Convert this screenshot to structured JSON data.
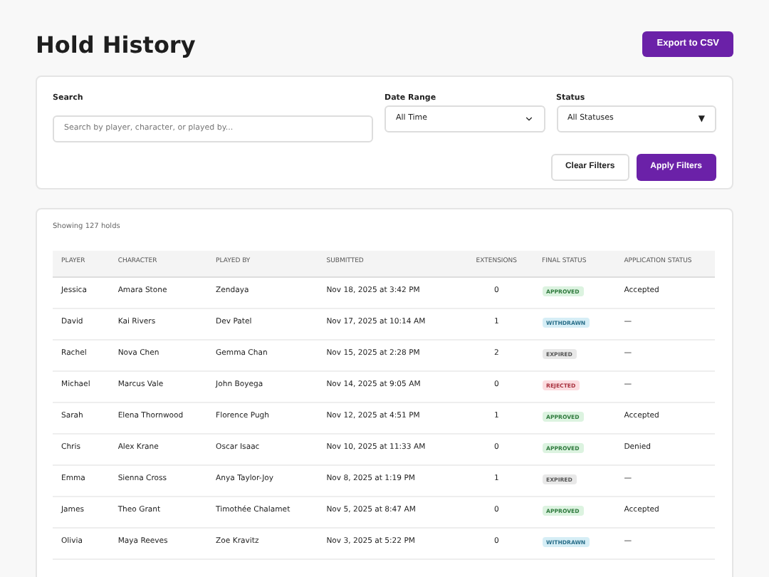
{
  "title": "Hold History",
  "export_button": "Export to CSV",
  "filters": {
    "search": {
      "label": "Search",
      "placeholder": "Search by player, character, or played by..."
    },
    "date_range": {
      "label": "Date Range",
      "value": "All Time"
    },
    "status": {
      "label": "Status",
      "value": "All Statuses",
      "caret": "▼"
    },
    "clear_button": "Clear Filters",
    "apply_button": "Apply Filters"
  },
  "summary": "Showing 127 holds",
  "table": {
    "columns": [
      "PLAYER",
      "CHARACTER",
      "PLAYED BY",
      "SUBMITTED",
      "EXTENSIONS",
      "FINAL STATUS",
      "APPLICATION STATUS"
    ],
    "rows": [
      {
        "player": "Jessica",
        "character": "Amara Stone",
        "played_by": "Zendaya",
        "submitted": "Nov 18, 2025 at 3:42 PM",
        "extensions": "0",
        "final_status": {
          "label": "APPROVED",
          "kind": "approved"
        },
        "application_status": "Accepted"
      },
      {
        "player": "David",
        "character": "Kai Rivers",
        "played_by": "Dev Patel",
        "submitted": "Nov 17, 2025 at 10:14 AM",
        "extensions": "1",
        "final_status": {
          "label": "WITHDRAWN",
          "kind": "withdrawn"
        },
        "application_status": "—"
      },
      {
        "player": "Rachel",
        "character": "Nova Chen",
        "played_by": "Gemma Chan",
        "submitted": "Nov 15, 2025 at 2:28 PM",
        "extensions": "2",
        "final_status": {
          "label": "EXPIRED",
          "kind": "expired"
        },
        "application_status": "—"
      },
      {
        "player": "Michael",
        "character": "Marcus Vale",
        "played_by": "John Boyega",
        "submitted": "Nov 14, 2025 at 9:05 AM",
        "extensions": "0",
        "final_status": {
          "label": "REJECTED",
          "kind": "rejected"
        },
        "application_status": "—"
      },
      {
        "player": "Sarah",
        "character": "Elena Thornwood",
        "played_by": "Florence Pugh",
        "submitted": "Nov 12, 2025 at 4:51 PM",
        "extensions": "1",
        "final_status": {
          "label": "APPROVED",
          "kind": "approved"
        },
        "application_status": "Accepted"
      },
      {
        "player": "Chris",
        "character": "Alex Krane",
        "played_by": "Oscar Isaac",
        "submitted": "Nov 10, 2025 at 11:33 AM",
        "extensions": "0",
        "final_status": {
          "label": "APPROVED",
          "kind": "approved"
        },
        "application_status": "Denied"
      },
      {
        "player": "Emma",
        "character": "Sienna Cross",
        "played_by": "Anya Taylor-Joy",
        "submitted": "Nov 8, 2025 at 1:19 PM",
        "extensions": "1",
        "final_status": {
          "label": "EXPIRED",
          "kind": "expired"
        },
        "application_status": "—"
      },
      {
        "player": "James",
        "character": "Theo Grant",
        "played_by": "Timothée Chalamet",
        "submitted": "Nov 5, 2025 at 8:47 AM",
        "extensions": "0",
        "final_status": {
          "label": "APPROVED",
          "kind": "approved"
        },
        "application_status": "Accepted"
      },
      {
        "player": "Olivia",
        "character": "Maya Reeves",
        "played_by": "Zoe Kravitz",
        "submitted": "Nov 3, 2025 at 5:22 PM",
        "extensions": "0",
        "final_status": {
          "label": "WITHDRAWN",
          "kind": "withdrawn"
        },
        "application_status": "—"
      }
    ]
  }
}
